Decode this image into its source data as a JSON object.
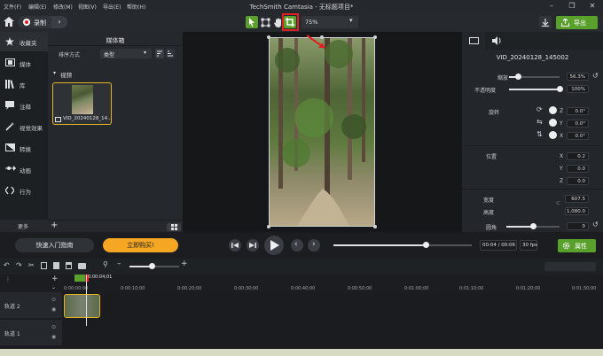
{
  "menu": [
    "文件(F)",
    "编辑(E)",
    "修改(M)",
    "视图(V)",
    "导出(E)",
    "帮助(H)"
  ],
  "app_title": "TechSmith Camtasia - 无标题项目*",
  "toolbar": {
    "record_label": "录制",
    "zoom_value": "75%",
    "export_label": "导出"
  },
  "nav": {
    "items": [
      "收藏夹",
      "媒体",
      "库",
      "注释",
      "视觉效果",
      "转换",
      "动画",
      "行为"
    ],
    "more_label": "更多"
  },
  "media_bin": {
    "title": "媒体箱",
    "sort_label": "排序方式",
    "sort_value": "类型",
    "section_label": "视频",
    "clip_name": "VID_20240128_14..."
  },
  "properties": {
    "clip_title": "VID_20240128_145002",
    "scale_label": "缩放",
    "scale_value": "56.3%",
    "opacity_label": "不透明度",
    "opacity_value": "100%",
    "rotation_label": "旋转",
    "rot_z_label": "Z",
    "rot_z": "0.0°",
    "rot_y_label": "Y",
    "rot_y": "0.0°",
    "rot_x_label": "X",
    "rot_x": "0.0°",
    "position_label": "位置",
    "pos_x_label": "X",
    "pos_x": "0.2",
    "pos_y_label": "Y",
    "pos_y": "0.0",
    "pos_z_label": "Z",
    "pos_z": "0.0",
    "width_label": "宽度",
    "width_value": "607.5",
    "height_label": "高度",
    "height_value": "1,080.0",
    "corner_label": "圆角",
    "corner_value": "0",
    "properties_button": "属性",
    "scale_fraction": 0.18,
    "opacity_fraction": 1.0,
    "corner_fraction": 0.5
  },
  "playback": {
    "quick_guide": "快速入门指南",
    "buy_now": "立即购买!",
    "time_display": "00:04 / 00:06",
    "fps": "30 fps",
    "progress_fraction": 0.67
  },
  "timeline": {
    "playhead_time": "0:00:04;01",
    "ruler_labels": [
      "0:00:00;00",
      "0:00:10;00",
      "0:00:20;00",
      "0:00:30;00",
      "0:00:40;00",
      "0:00:50;00",
      "0:01:00;00",
      "0:01:10;00",
      "0:01:20;00",
      "0:01:30;00"
    ],
    "tracks": [
      "轨道 2",
      "轨道 1"
    ],
    "zoom_fraction": 0.45
  },
  "colors": {
    "accent_green": "#5aa02c",
    "buy_orange": "#f5a623",
    "highlight_red": "#e02020",
    "clip_border": "#e6b422"
  }
}
